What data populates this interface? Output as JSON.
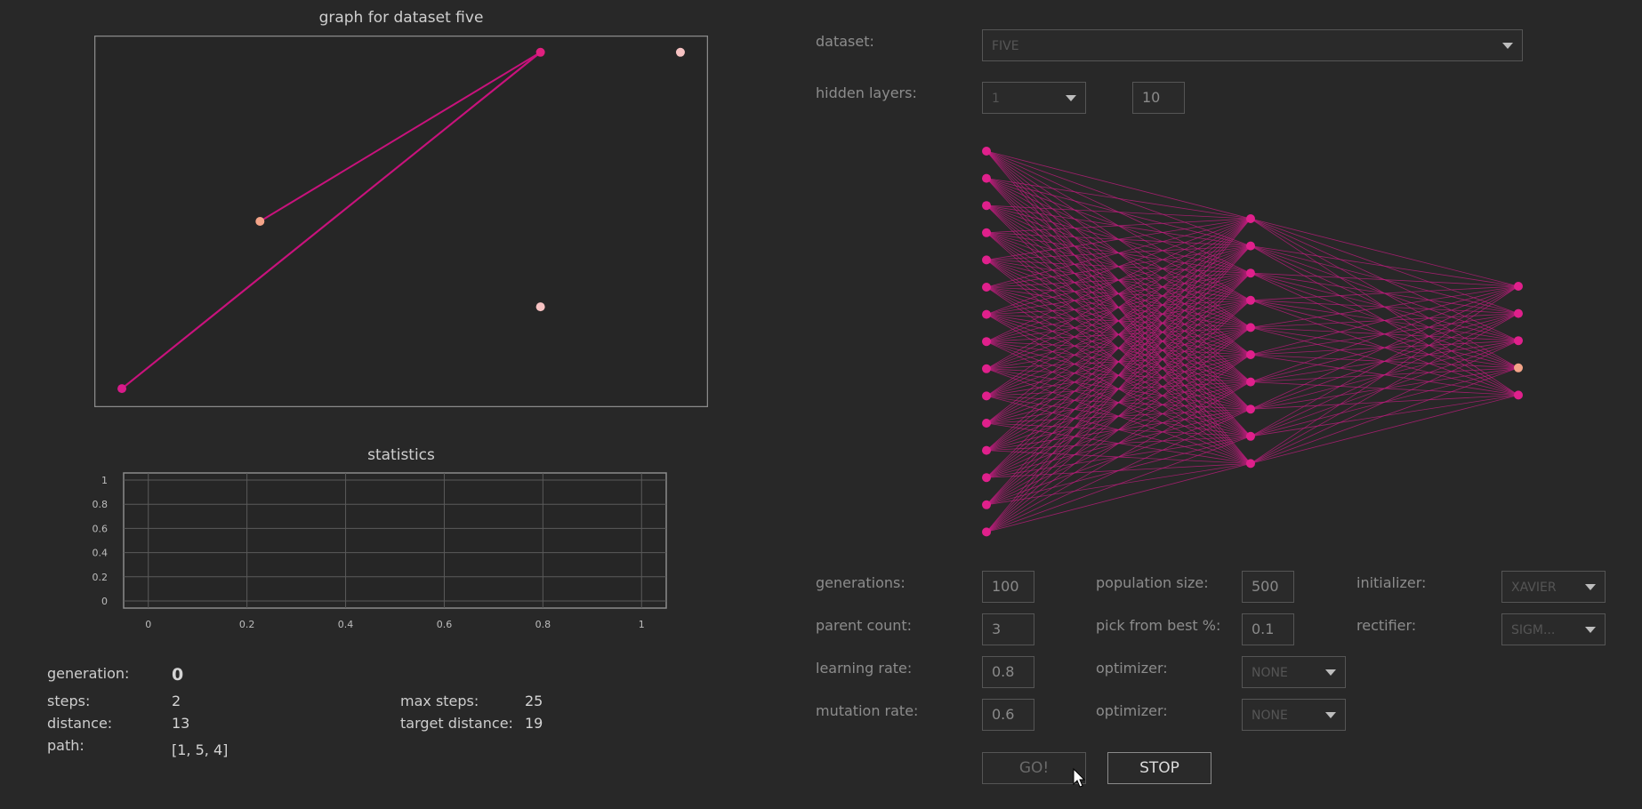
{
  "graph": {
    "title": "graph for dataset five",
    "line_color": "#c8127c",
    "points": [
      {
        "x": 0.045,
        "y": 0.05,
        "color": "#d81b8a"
      },
      {
        "x": 0.27,
        "y": 0.5,
        "color": "#f4a488"
      },
      {
        "x": 0.727,
        "y": 0.955,
        "color": "#e0207f"
      },
      {
        "x": 0.727,
        "y": 0.27,
        "color": "#f6c2c2"
      },
      {
        "x": 0.955,
        "y": 0.955,
        "color": "#f6c2c2"
      }
    ],
    "path_points": [
      1,
      2,
      0,
      2
    ]
  },
  "statistics": {
    "title": "statistics",
    "chart_data": {
      "type": "line",
      "title": "statistics",
      "xlabel": "",
      "ylabel": "",
      "x_ticks": [
        "0",
        "0.2",
        "0.4",
        "0.6",
        "0.8",
        "1"
      ],
      "y_ticks": [
        "0",
        "0.2",
        "0.4",
        "0.6",
        "0.8",
        "1"
      ],
      "xlim": [
        -0.05,
        1.05
      ],
      "ylim": [
        0,
        1
      ],
      "grid": true,
      "series": []
    }
  },
  "stats": {
    "generation_label": "generation:",
    "generation_value": "0",
    "steps_label": "steps:",
    "steps_value": "2",
    "distance_label": "distance:",
    "distance_value": "13",
    "path_label": "path:",
    "path_value": "[1, 5, 4]",
    "max_steps_label": "max steps:",
    "max_steps_value": "25",
    "target_distance_label": "target distance:",
    "target_distance_value": "19"
  },
  "controls": {
    "dataset_label": "dataset:",
    "dataset_value": "FIVE",
    "hidden_layers_label": "hidden layers:",
    "hidden_layers_value": "1",
    "hidden_size_value": "10",
    "generations_label": "generations:",
    "generations_value": "100",
    "population_size_label": "population size:",
    "population_size_value": "500",
    "initializer_label": "initializer:",
    "initializer_value": "XAVIER",
    "parent_count_label": "parent count:",
    "parent_count_value": "3",
    "pick_from_best_label": "pick from best %:",
    "pick_from_best_value": "0.1",
    "rectifier_label": "rectifier:",
    "rectifier_value": "SIGM...",
    "learning_rate_label": "learning rate:",
    "learning_rate_value": "0.8",
    "optimizer1_label": "optimizer:",
    "optimizer1_value": "NONE",
    "mutation_rate_label": "mutation rate:",
    "mutation_rate_value": "0.6",
    "optimizer2_label": "optimizer:",
    "optimizer2_value": "NONE",
    "go_label": "GO!",
    "stop_label": "STOP"
  },
  "network": {
    "layers": [
      15,
      10,
      5
    ],
    "node_color": "#e0208c",
    "edge_color": "#c41c80",
    "highlight_color": "#f4a488",
    "highlight_output_index": 3
  }
}
